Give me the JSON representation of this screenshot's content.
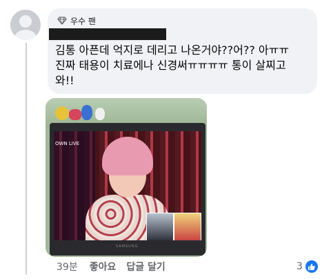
{
  "comment": {
    "badge_label": "우수 팬",
    "text_lines": [
      "김통 아픈데 억지로 데리고 나온거야??어?? 아ㅠㅠ",
      "진짜 태용이 치료에나 신경써ㅠㅠㅠㅠ 통이 살찌고",
      "와!!"
    ],
    "photo": {
      "screen_overlay_text": "OWN LIVE",
      "laptop_brand": "SAMSUNG"
    }
  },
  "actions": {
    "time": "39분",
    "like_label": "좋아요",
    "reply_label": "답글 달기"
  },
  "reactions": {
    "count": "3",
    "icon": "thumbs-up-icon",
    "color": "#1877f2"
  },
  "colors": {
    "bubble": "#f0f2f5",
    "text": "#050505",
    "meta": "#65676b"
  }
}
